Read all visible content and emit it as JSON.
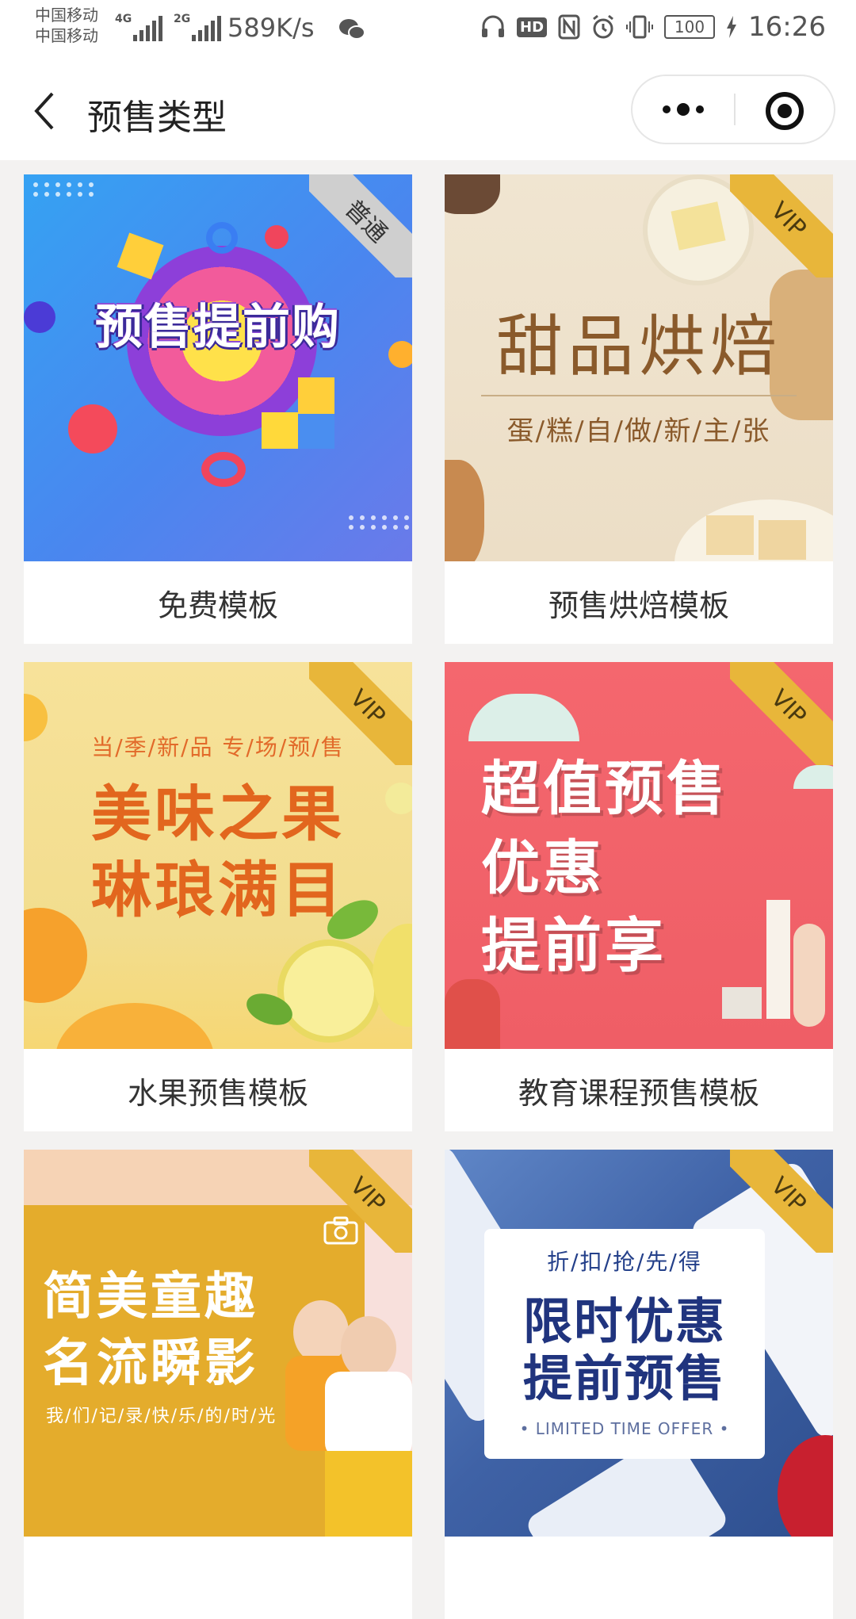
{
  "status_bar": {
    "carrier_1": "中国移动",
    "carrier_2": "中国移动",
    "net_1": "4G",
    "net_2": "2G",
    "speed": "589K/s",
    "hd_badge": "HD",
    "battery": "100",
    "time": "16:26"
  },
  "nav": {
    "title": "预售类型"
  },
  "cards": [
    {
      "caption": "免费模板",
      "ribbon": "普通",
      "headline": "预售提前购"
    },
    {
      "caption": "预售烘焙模板",
      "ribbon": "VIP",
      "headline": "甜品烘焙",
      "sub": "蛋/糕/自/做/新/主/张"
    },
    {
      "caption": "水果预售模板",
      "ribbon": "VIP",
      "top": "当/季/新/品  专/场/预/售",
      "line1": "美味之果",
      "line2": "琳琅满目"
    },
    {
      "caption": "教育课程预售模板",
      "ribbon": "VIP",
      "line1": "超值预售",
      "line2": "优惠",
      "line3": "提前享"
    },
    {
      "caption": "",
      "ribbon": "VIP",
      "line1": "简美童趣",
      "line2": "名流瞬影",
      "sub": "我/们/记/录/快/乐/的/时/光"
    },
    {
      "caption": "",
      "ribbon": "VIP",
      "top": "折/扣/抢/先/得",
      "line1": "限时优惠",
      "line2": "提前预售",
      "en": "• LIMITED TIME OFFER •"
    }
  ],
  "colors": {
    "vip_ribbon": "#e8b63a",
    "normal_ribbon": "#cfcfcf",
    "page_bg": "#f3f2f1"
  }
}
